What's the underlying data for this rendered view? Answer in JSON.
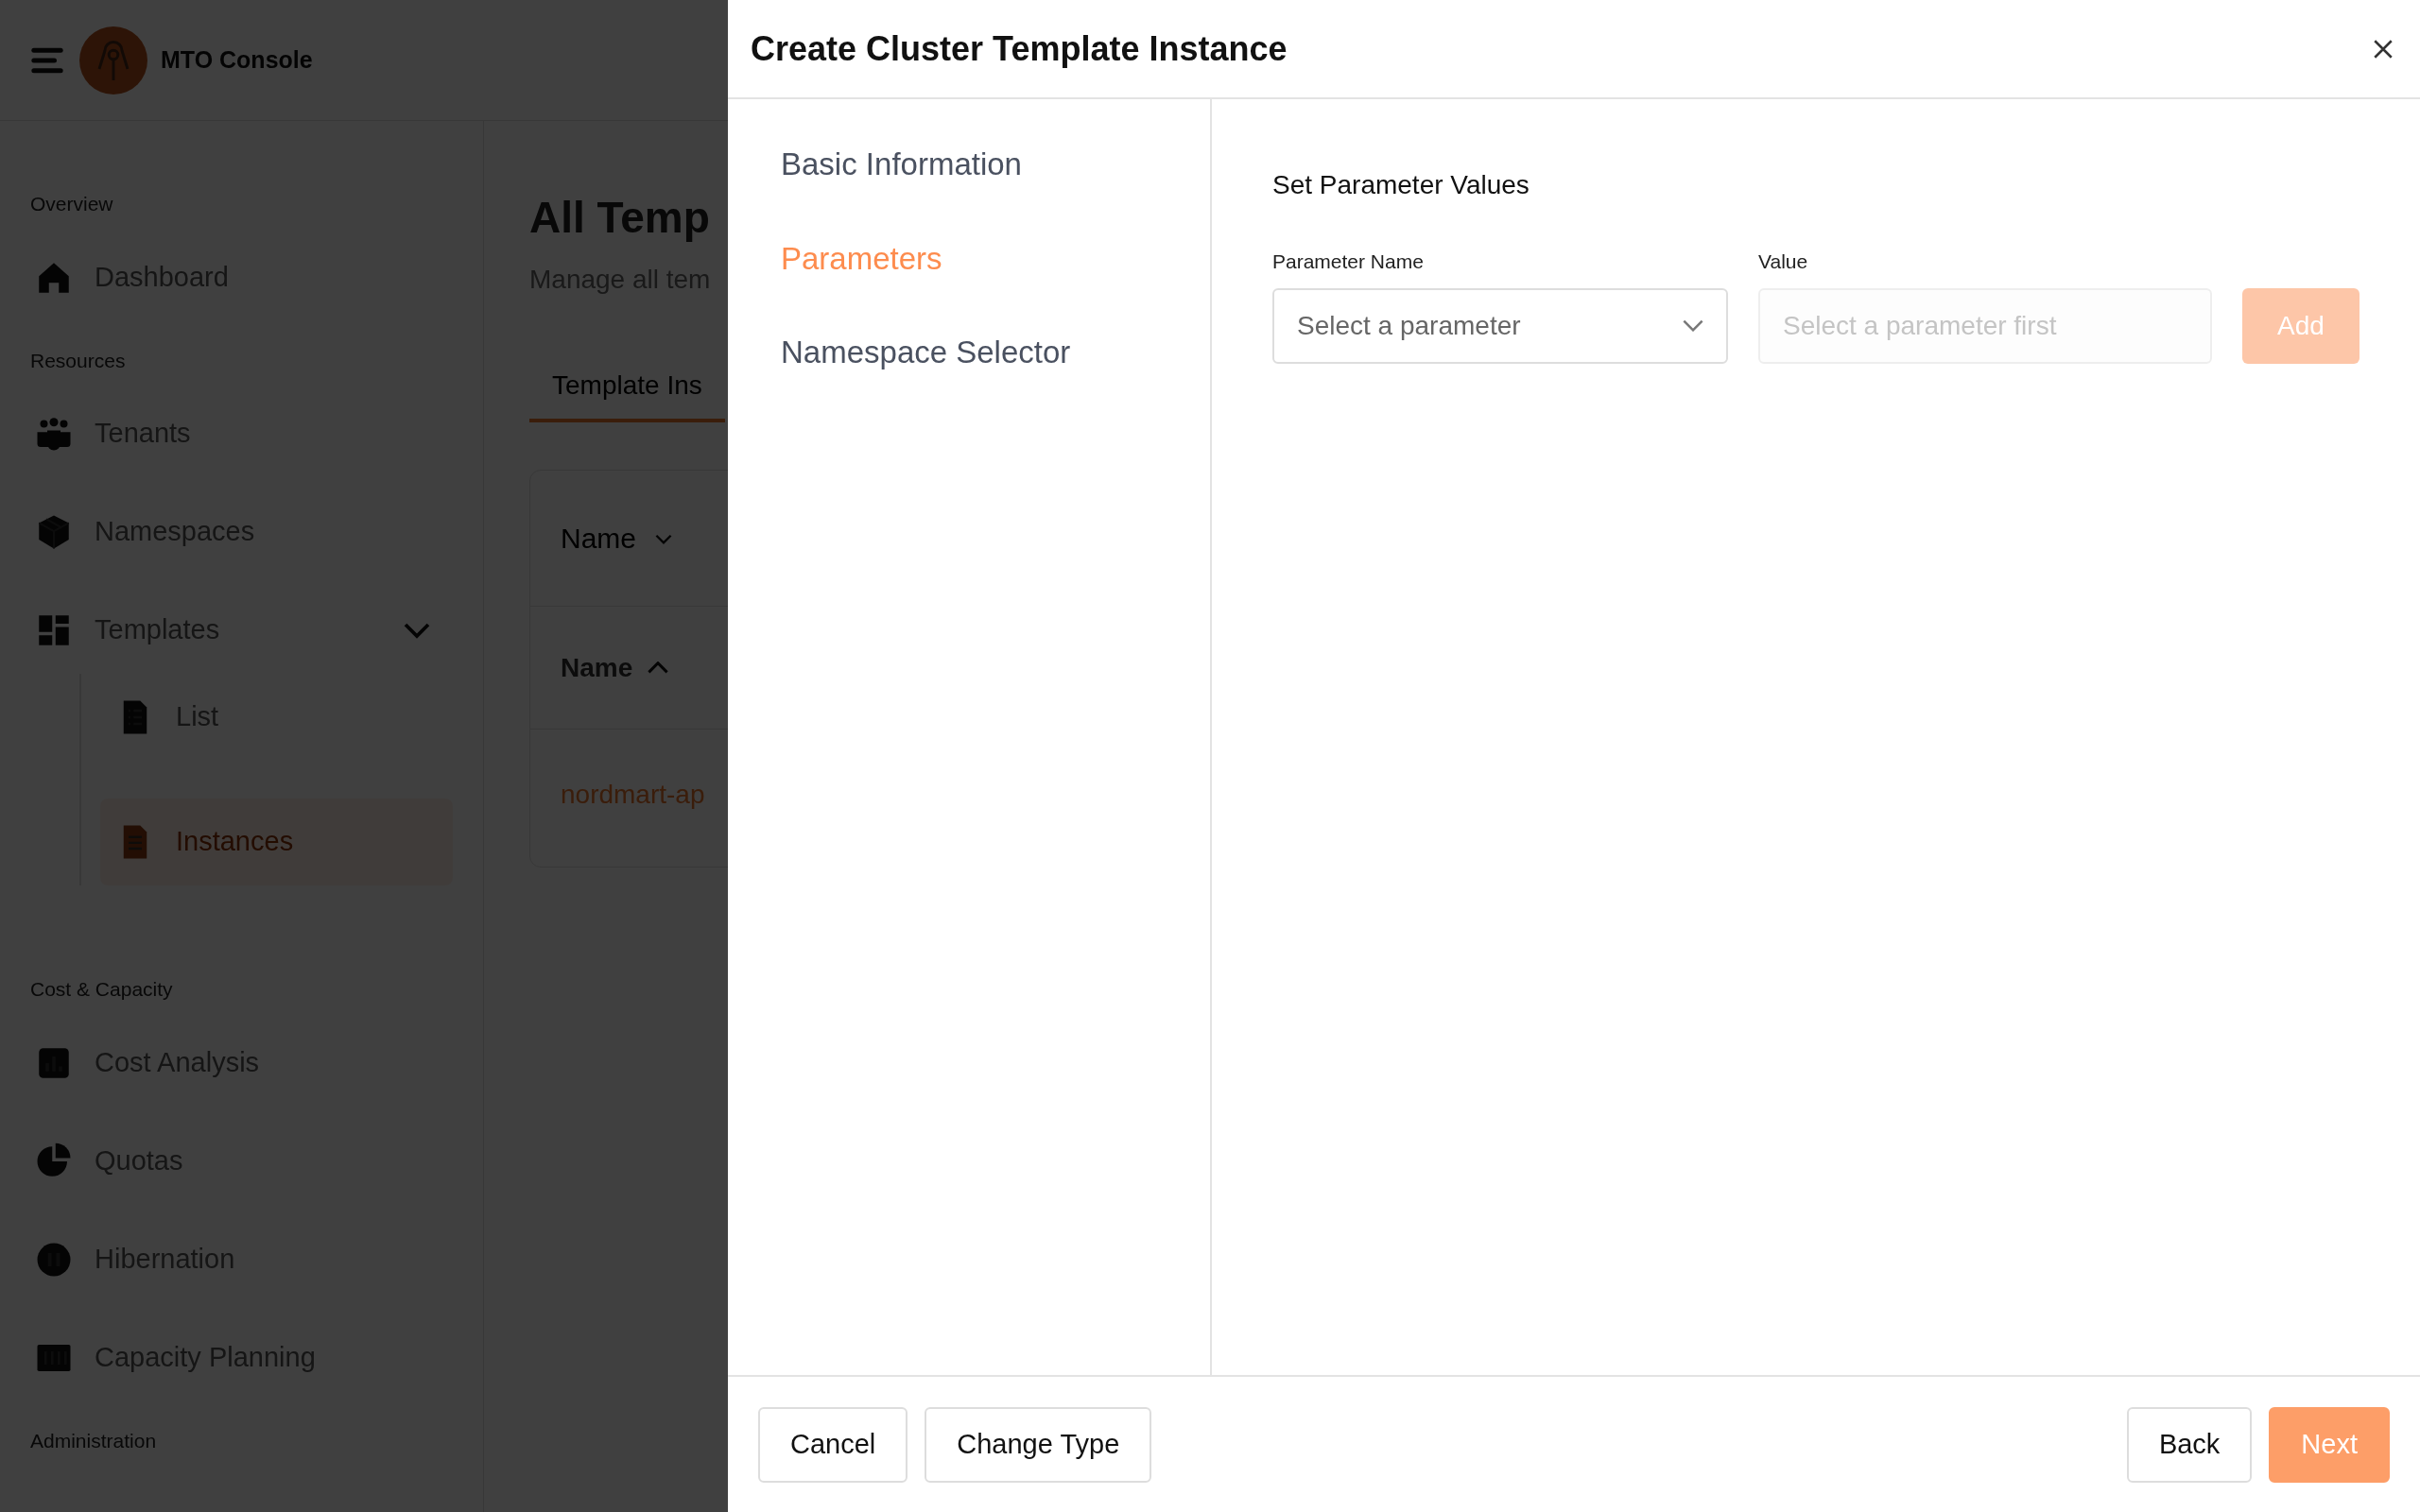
{
  "app_header": {
    "title": "MTO Console"
  },
  "sidebar": {
    "sections": [
      {
        "label": "Overview",
        "items": [
          {
            "label": "Dashboard",
            "selected": false
          }
        ]
      },
      {
        "label": "Resources",
        "items": [
          {
            "label": "Tenants",
            "selected": false
          },
          {
            "label": "Namespaces",
            "selected": false
          },
          {
            "label": "Templates",
            "selected": false,
            "expanded": true,
            "children": [
              {
                "label": "List",
                "selected": false
              },
              {
                "label": "Instances",
                "selected": true
              }
            ]
          }
        ]
      },
      {
        "label": "Cost & Capacity",
        "items": [
          {
            "label": "Cost Analysis",
            "selected": false
          },
          {
            "label": "Quotas",
            "selected": false
          },
          {
            "label": "Hibernation",
            "selected": false
          },
          {
            "label": "Capacity Planning",
            "selected": false
          }
        ]
      },
      {
        "label": "Administration"
      }
    ]
  },
  "page": {
    "title": "All Temp",
    "subtitle": "Manage all tem",
    "tabs": [
      {
        "label": "Template Ins",
        "selected": true
      }
    ],
    "filter": {
      "label": "Name"
    },
    "table": {
      "columns": [
        {
          "label": "Name"
        }
      ],
      "rows": [
        [
          "nordmart-ap"
        ]
      ]
    }
  },
  "dialog": {
    "title": "Create Cluster Template Instance",
    "steps": [
      {
        "label": "Basic Information",
        "selected": false
      },
      {
        "label": "Parameters",
        "selected": true
      },
      {
        "label": "Namespace Selector",
        "selected": false
      }
    ],
    "section_title": "Set Parameter Values",
    "parameter_name": {
      "label": "Parameter Name",
      "placeholder": "Select a parameter"
    },
    "value": {
      "label": "Value",
      "placeholder": "Select a parameter first",
      "disabled": true
    },
    "add_button": {
      "label": "Add",
      "disabled": true
    },
    "footer": {
      "left": [
        {
          "label": "Cancel",
          "kind": "secondary"
        },
        {
          "label": "Change Type",
          "kind": "secondary"
        }
      ],
      "right": [
        {
          "label": "Back",
          "kind": "secondary"
        },
        {
          "label": "Next",
          "kind": "primary"
        }
      ]
    }
  }
}
